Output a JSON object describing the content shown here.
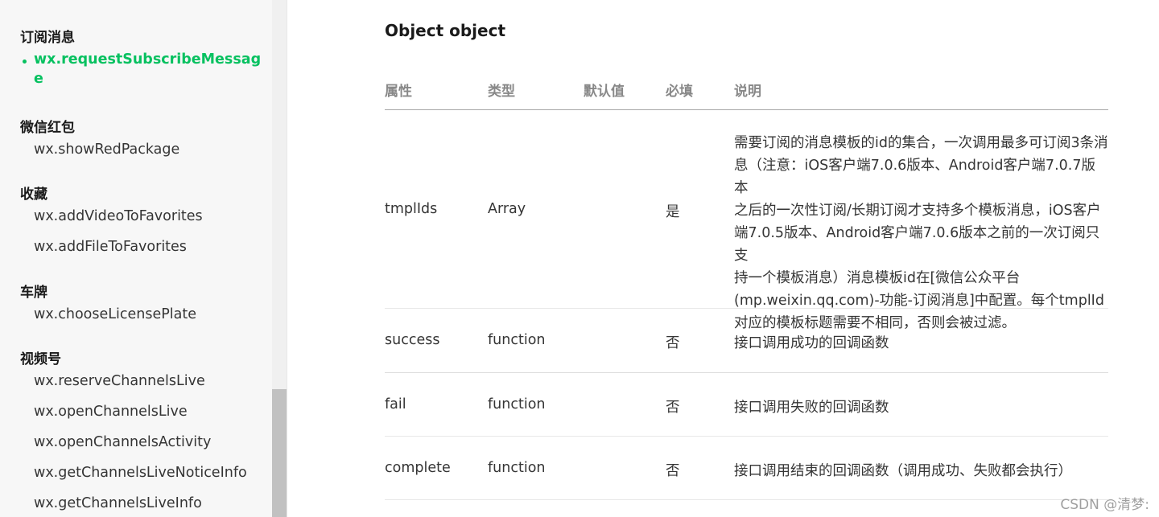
{
  "sidebar": {
    "groups": [
      {
        "title": "订阅消息",
        "items": [
          {
            "label_line1": "wx.requestSubscribeMessag",
            "label_line2": "e",
            "active": true
          }
        ]
      },
      {
        "title": "微信红包",
        "items": [
          {
            "label": "wx.showRedPackage"
          }
        ]
      },
      {
        "title": "收藏",
        "items": [
          {
            "label": "wx.addVideoToFavorites"
          },
          {
            "label": "wx.addFileToFavorites"
          }
        ]
      },
      {
        "title": "车牌",
        "items": [
          {
            "label": "wx.chooseLicensePlate"
          }
        ]
      },
      {
        "title": "视频号",
        "items": [
          {
            "label": "wx.reserveChannelsLive"
          },
          {
            "label": "wx.openChannelsLive"
          },
          {
            "label": "wx.openChannelsActivity"
          },
          {
            "label": "wx.getChannelsLiveNoticeInfo"
          },
          {
            "label": "wx.getChannelsLiveInfo"
          }
        ]
      }
    ]
  },
  "main": {
    "section_title": "Object object",
    "table": {
      "headers": [
        "属性",
        "类型",
        "默认值",
        "必填",
        "说明"
      ],
      "rows": [
        {
          "property": "tmplIds",
          "type": "Array",
          "default": "",
          "required": "是",
          "description_lines": [
            "需要订阅的消息模板的id的集合，一次调用最多可订阅3条消",
            "息（注意：iOS客户端7.0.6版本、Android客户端7.0.7版本",
            "之后的一次性订阅/长期订阅才支持多个模板消息，iOS客户",
            "端7.0.5版本、Android客户端7.0.6版本之前的一次订阅只支",
            "持一个模板消息）消息模板id在[微信公众平台",
            "(mp.weixin.qq.com)-功能-订阅消息]中配置。每个tmplId",
            "对应的模板标题需要不相同，否则会被过滤。"
          ]
        },
        {
          "property": "success",
          "type": "function",
          "default": "",
          "required": "否",
          "description": "接口调用成功的回调函数"
        },
        {
          "property": "fail",
          "type": "function",
          "default": "",
          "required": "否",
          "description": "接口调用失败的回调函数"
        },
        {
          "property": "complete",
          "type": "function",
          "default": "",
          "required": "否",
          "description": "接口调用结束的回调函数（调用成功、失败都会执行）"
        }
      ]
    }
  },
  "watermark": "CSDN @清梦:",
  "colors": {
    "accent": "#07c160",
    "sidebar_bg": "#f7f7f7",
    "header_text": "#888888"
  }
}
